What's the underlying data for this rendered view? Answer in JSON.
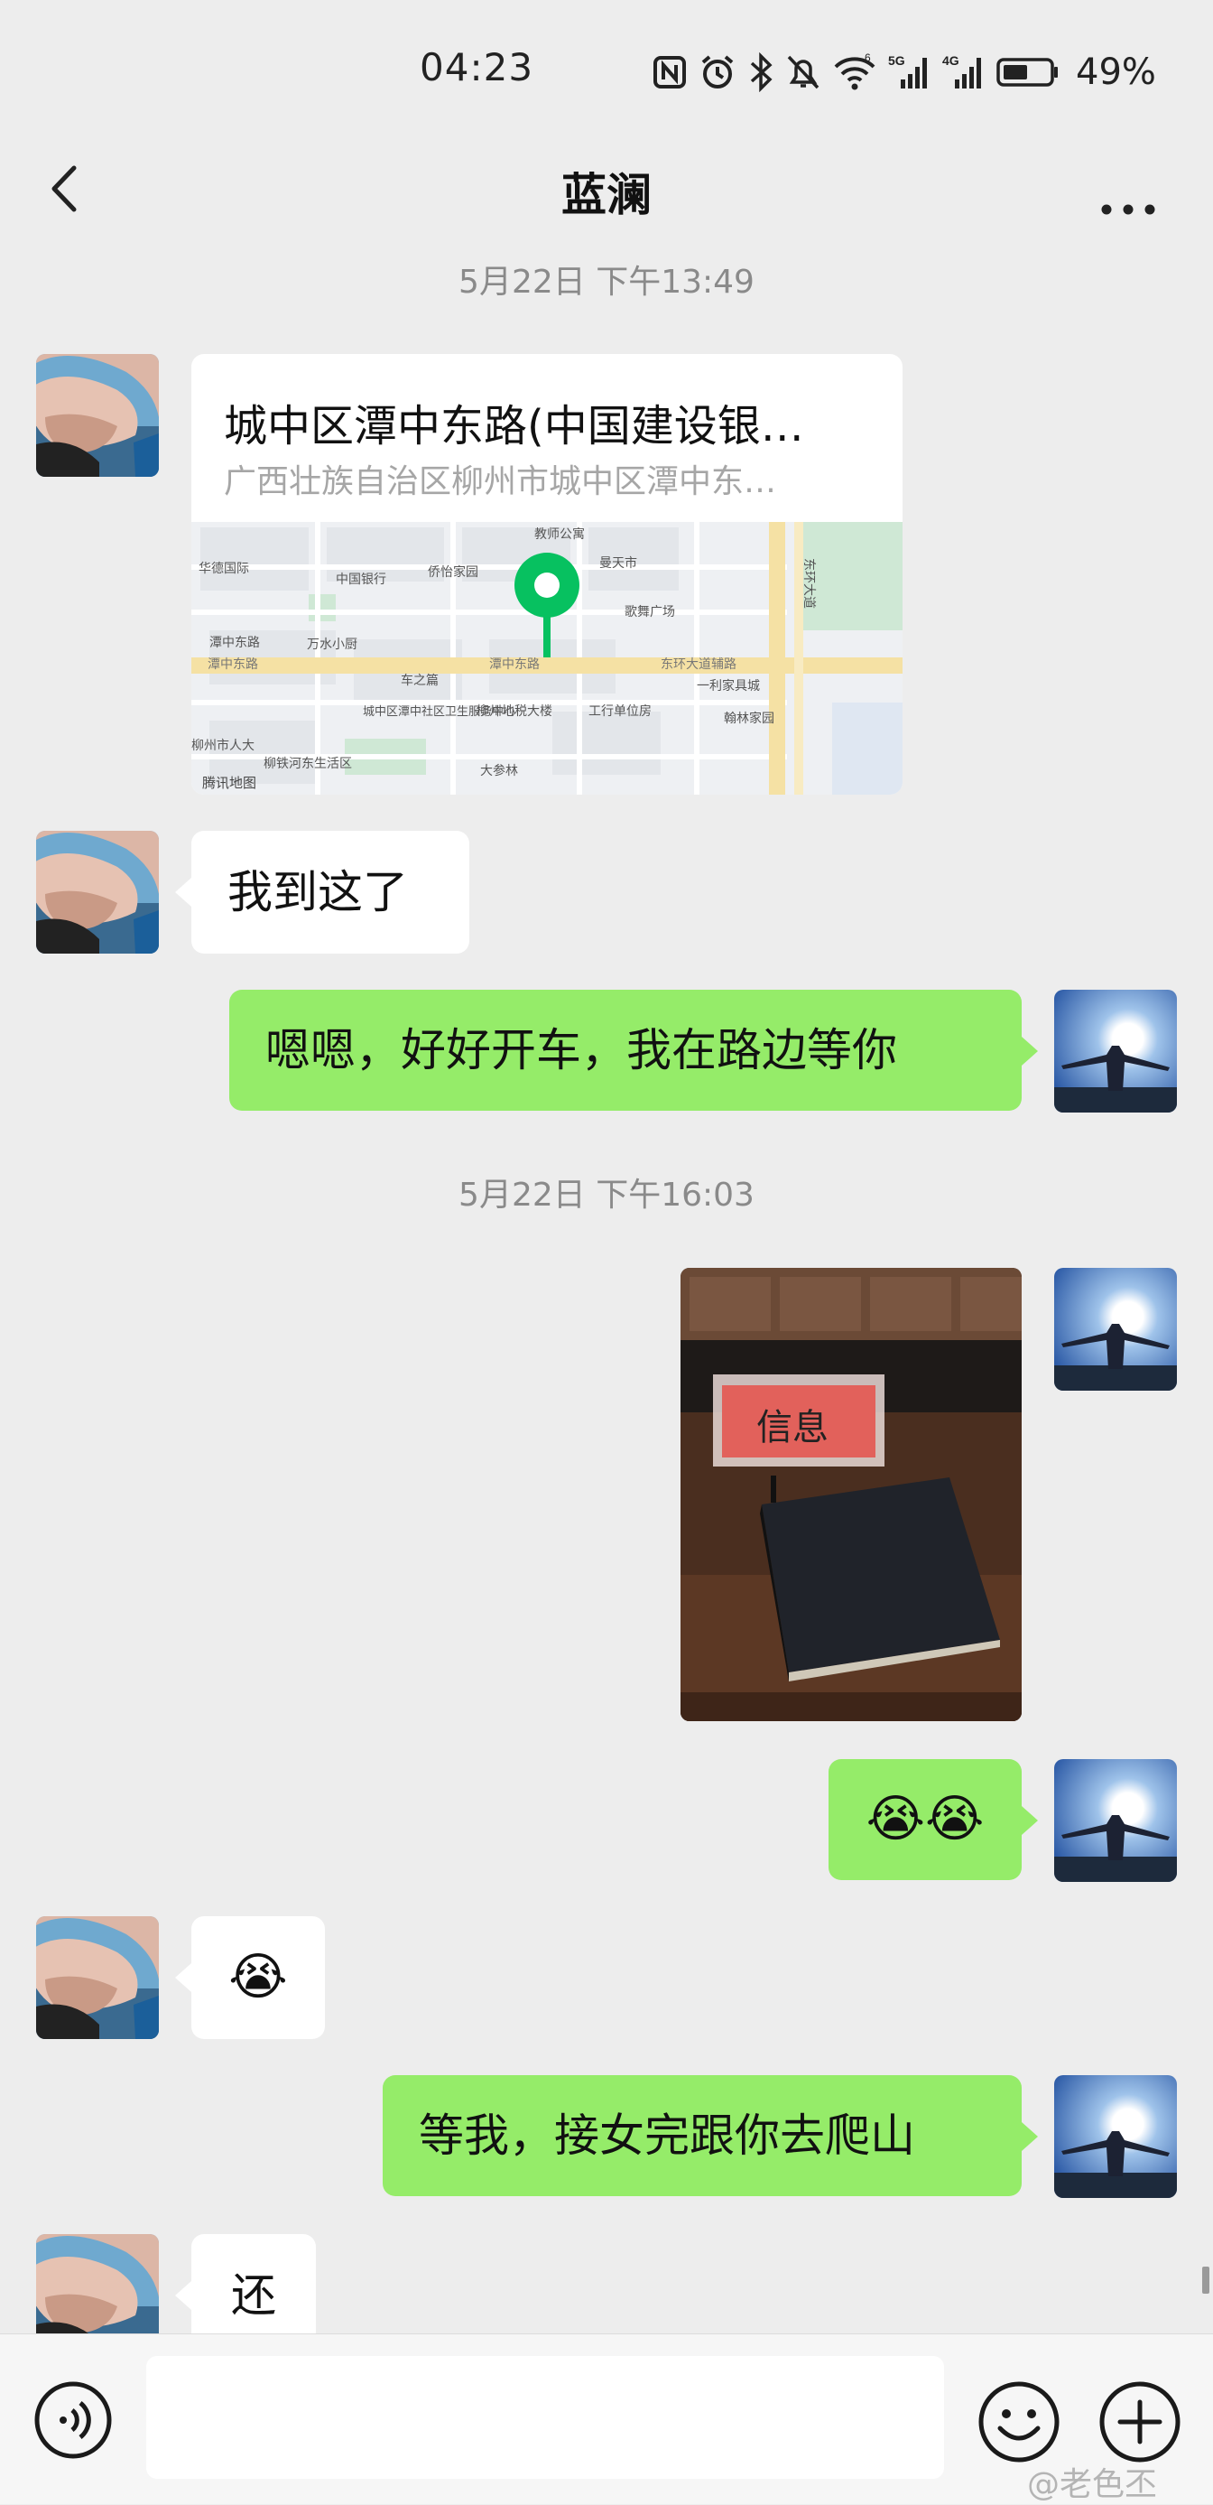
{
  "status_bar": {
    "time": "04:23",
    "battery_percent": "49%",
    "network_labels": [
      "5G",
      "4G"
    ],
    "icons": [
      "nfc-icon",
      "alarm-icon",
      "bluetooth-icon",
      "mute-icon",
      "wifi-icon",
      "signal-5g-icon",
      "signal-4g-icon",
      "battery-icon"
    ]
  },
  "header": {
    "title": "蓝澜",
    "back_icon": "chevron-left-icon",
    "more_icon": "more-dots-icon"
  },
  "messages": [
    {
      "type": "timestamp",
      "text": "5月22日 下午13:49"
    },
    {
      "type": "location",
      "sender": "contact",
      "title": "城中区潭中东路(中国建设银…",
      "address": "广西壮族自治区柳州市城中区潭中东…",
      "map_provider": "腾讯地图"
    },
    {
      "type": "text",
      "sender": "contact",
      "text": "我到这了"
    },
    {
      "type": "text",
      "sender": "me",
      "text": "嗯嗯，好好开车，我在路边等你"
    },
    {
      "type": "timestamp",
      "text": "5月22日 下午16:03"
    },
    {
      "type": "image",
      "sender": "me",
      "sign_text": "信息"
    },
    {
      "type": "emoji",
      "sender": "me",
      "emoji": [
        "😭",
        "😭"
      ]
    },
    {
      "type": "emoji",
      "sender": "contact",
      "emoji": [
        "😭"
      ]
    },
    {
      "type": "text",
      "sender": "me",
      "text": "等我，接女完跟你去爬山"
    },
    {
      "type": "text",
      "sender": "contact",
      "text": "还"
    }
  ],
  "map_labels": {
    "pins": [
      "教师公寓",
      "曼天市",
      "歌舞广场",
      "东环大道",
      "东环大道辅路",
      "潭中东路",
      "潭中东路",
      "潭中东路",
      "中国银行",
      "侨怡家园",
      "万水小厨",
      "华德国际",
      "车之篇",
      "城中区潭中社区卫生服务中心",
      "柳州地税大楼",
      "工行单位房",
      "一利家具城",
      "翰林家园",
      "柳州市人大",
      "柳铁河东生活区",
      "大参林",
      "腾讯地图"
    ]
  },
  "input_bar": {
    "voice_icon": "voice-icon",
    "emoji_icon": "emoji-icon",
    "plus_icon": "plus-icon"
  },
  "watermark": "@老色丕",
  "colors": {
    "background": "#ededed",
    "bubble_out": "#95ec69",
    "bubble_in": "#ffffff",
    "pin_green": "#07c160"
  }
}
